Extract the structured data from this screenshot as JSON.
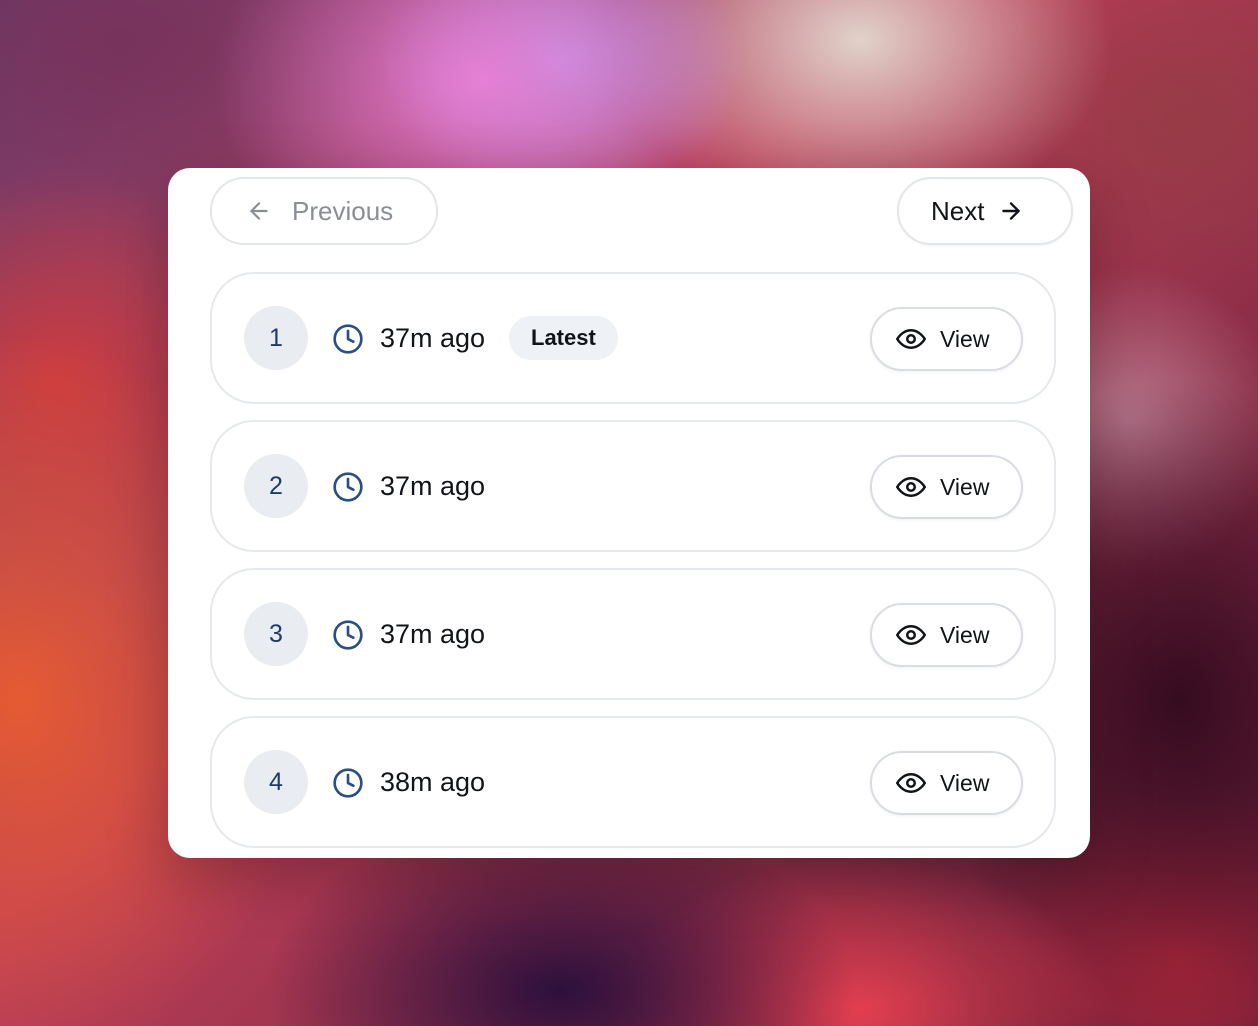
{
  "pagination": {
    "previous_label": "Previous",
    "next_label": "Next"
  },
  "versions": [
    {
      "number": "1",
      "time": "37m ago",
      "badge": "Latest",
      "view_label": "View"
    },
    {
      "number": "2",
      "time": "37m ago",
      "badge": null,
      "view_label": "View"
    },
    {
      "number": "3",
      "time": "37m ago",
      "badge": null,
      "view_label": "View"
    },
    {
      "number": "4",
      "time": "38m ago",
      "badge": null,
      "view_label": "View"
    }
  ],
  "icons": {
    "previous": "arrow-left-icon",
    "next": "arrow-right-icon",
    "time": "clock-icon",
    "view": "eye-icon"
  },
  "colors": {
    "badge_number_text": "#1f3b6b",
    "clock_icon": "#2b4f80",
    "previous_text": "#8a8e95",
    "primary_text": "#111418"
  }
}
